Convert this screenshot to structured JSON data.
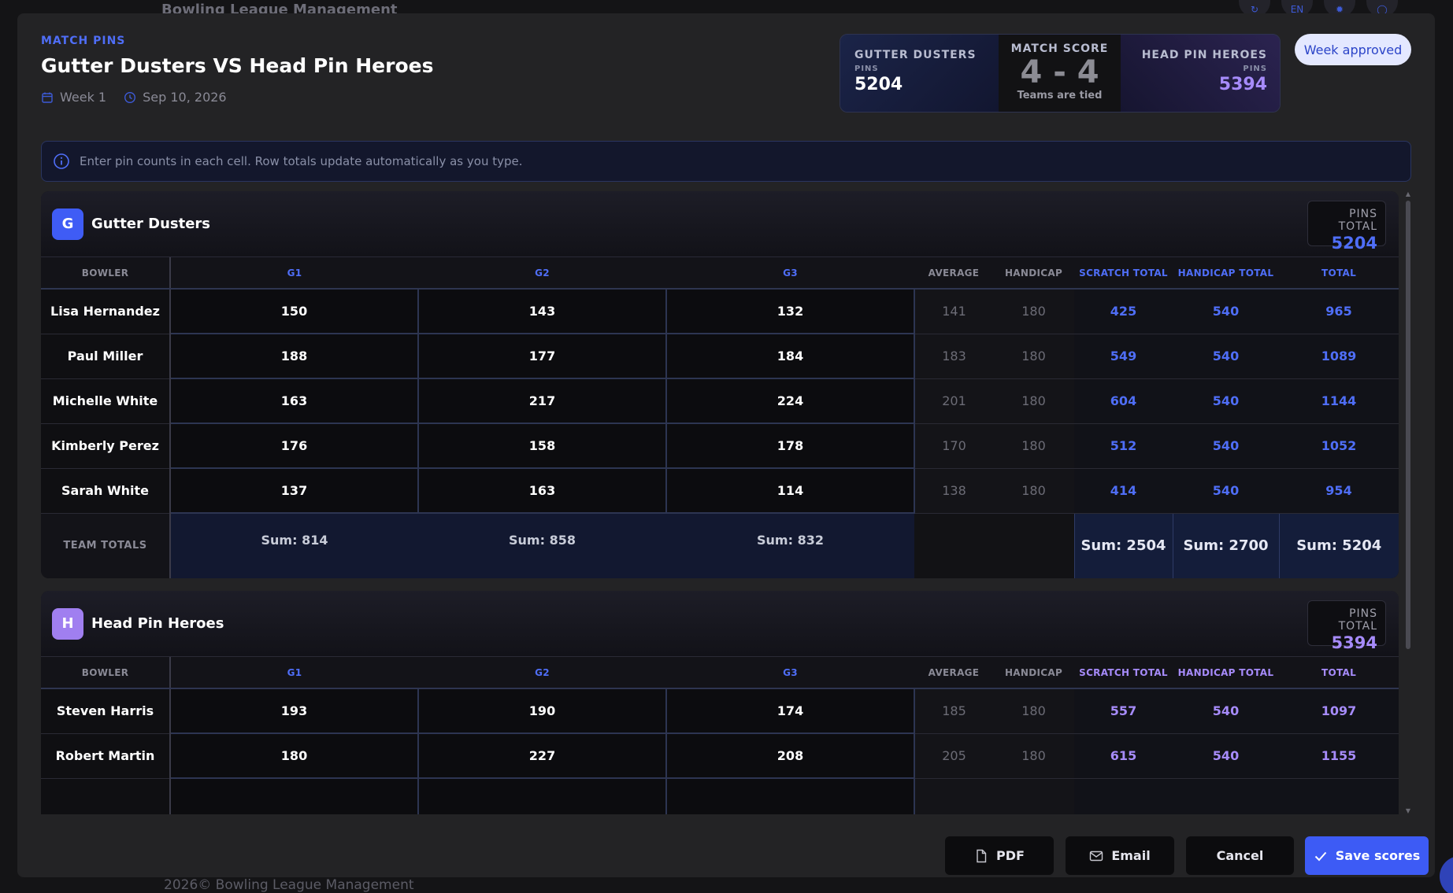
{
  "background": {
    "app_title": "Bowling League Management",
    "lang": "EN",
    "footer": "2026©  Bowling League Management"
  },
  "header": {
    "kicker": "MATCH PINS",
    "title": "Gutter Dusters VS Head Pin Heroes",
    "week": "Week 1",
    "date": "Sep 10, 2026"
  },
  "scoreboard": {
    "left_team": "GUTTER DUSTERS",
    "left_pins_label": "PINS",
    "left_pins": "5204",
    "match_score_label": "MATCH SCORE",
    "match_score": "4 - 4",
    "status": "Teams are tied",
    "right_team": "HEAD PIN HEROES",
    "right_pins_label": "PINS",
    "right_pins": "5394"
  },
  "week_badge": "Week approved",
  "info_text": "Enter pin counts in each cell. Row totals update automatically as you type.",
  "columns": {
    "bowler": "BOWLER",
    "g1": "G1",
    "g2": "G2",
    "g3": "G3",
    "average": "AVERAGE",
    "handicap": "HANDICAP",
    "scratch_total": "SCRATCH TOTAL",
    "handicap_total": "HANDICAP TOTAL",
    "total": "TOTAL"
  },
  "teams": [
    {
      "initial": "G",
      "name": "Gutter Dusters",
      "pins_total_label": "PINS TOTAL",
      "pins_total": "5204",
      "rows": [
        {
          "name": "Lisa Hernandez",
          "g1": "150",
          "g2": "143",
          "g3": "132",
          "avg": "141",
          "hcp": "180",
          "scratch": "425",
          "hcp_total": "540",
          "total": "965"
        },
        {
          "name": "Paul Miller",
          "g1": "188",
          "g2": "177",
          "g3": "184",
          "avg": "183",
          "hcp": "180",
          "scratch": "549",
          "hcp_total": "540",
          "total": "1089"
        },
        {
          "name": "Michelle White",
          "g1": "163",
          "g2": "217",
          "g3": "224",
          "avg": "201",
          "hcp": "180",
          "scratch": "604",
          "hcp_total": "540",
          "total": "1144"
        },
        {
          "name": "Kimberly Perez",
          "g1": "176",
          "g2": "158",
          "g3": "178",
          "avg": "170",
          "hcp": "180",
          "scratch": "512",
          "hcp_total": "540",
          "total": "1052"
        },
        {
          "name": "Sarah White",
          "g1": "137",
          "g2": "163",
          "g3": "114",
          "avg": "138",
          "hcp": "180",
          "scratch": "414",
          "hcp_total": "540",
          "total": "954"
        }
      ],
      "totals": {
        "label": "TEAM TOTALS",
        "g1": "Sum: 814",
        "g2": "Sum: 858",
        "g3": "Sum: 832",
        "scratch": "Sum: 2504",
        "hcp_total": "Sum: 2700",
        "total": "Sum: 5204"
      }
    },
    {
      "initial": "H",
      "name": "Head Pin Heroes",
      "pins_total_label": "PINS TOTAL",
      "pins_total": "5394",
      "rows": [
        {
          "name": "Steven Harris",
          "g1": "193",
          "g2": "190",
          "g3": "174",
          "avg": "185",
          "hcp": "180",
          "scratch": "557",
          "hcp_total": "540",
          "total": "1097"
        },
        {
          "name": "Robert Martin",
          "g1": "180",
          "g2": "227",
          "g3": "208",
          "avg": "205",
          "hcp": "180",
          "scratch": "615",
          "hcp_total": "540",
          "total": "1155"
        }
      ]
    }
  ],
  "buttons": {
    "pdf": "PDF",
    "email": "Email",
    "cancel": "Cancel",
    "save": "Save scores"
  },
  "colors": {
    "accent_blue": "#4f6ef7",
    "accent_purple": "#a68bfa",
    "primary_button": "#3d5bf5"
  }
}
